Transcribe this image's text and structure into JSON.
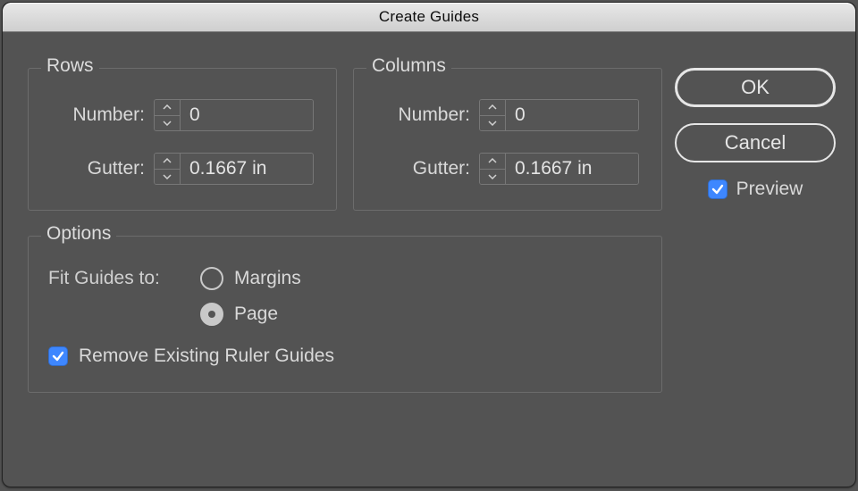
{
  "title": "Create Guides",
  "rows": {
    "legend": "Rows",
    "number_label": "Number:",
    "number_value": "0",
    "gutter_label": "Gutter:",
    "gutter_value": "0.1667 in"
  },
  "columns": {
    "legend": "Columns",
    "number_label": "Number:",
    "number_value": "0",
    "gutter_label": "Gutter:",
    "gutter_value": "0.1667 in"
  },
  "options": {
    "legend": "Options",
    "fit_label": "Fit Guides to:",
    "margins_label": "Margins",
    "page_label": "Page",
    "fit_selected": "page",
    "remove_label": "Remove Existing Ruler Guides",
    "remove_checked": true
  },
  "buttons": {
    "ok": "OK",
    "cancel": "Cancel",
    "preview_label": "Preview",
    "preview_checked": true
  }
}
